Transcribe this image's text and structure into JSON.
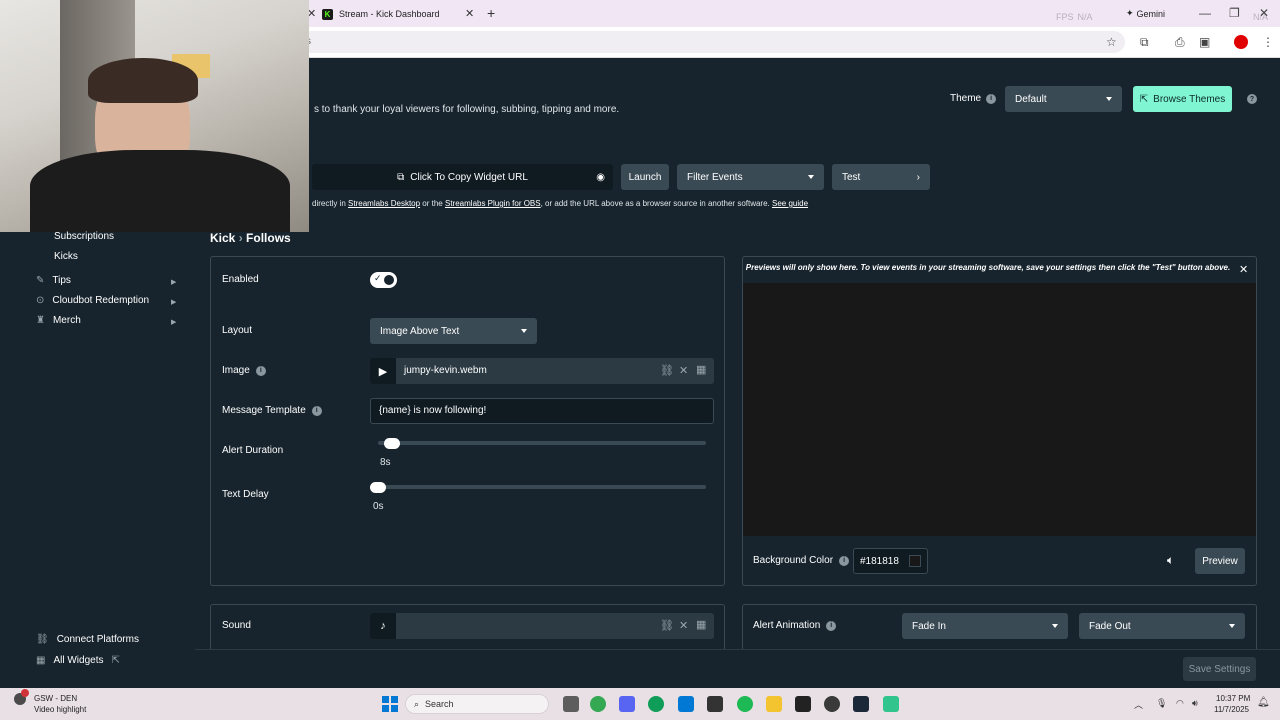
{
  "browser": {
    "tabs": [
      {
        "label": "Stream - Kick Dashboard"
      }
    ],
    "overlay_stats": {
      "fps": "FPS",
      "na1": "N/A",
      "gemini": "Gemini",
      "na2": "N/A"
    }
  },
  "header": {
    "description": "s to thank your loyal viewers for following, subbing, tipping and more.",
    "theme_label": "Theme",
    "theme_value": "Default",
    "browse_themes": "Browse Themes",
    "copy_url": "Click To Copy Widget URL",
    "launch": "Launch",
    "filter_events": "Filter Events",
    "test": "Test",
    "guide_prefix": "directly in",
    "guide_link1": "Streamlabs Desktop",
    "guide_mid": "or the",
    "guide_link2": "Streamlabs Plugin for OBS",
    "guide_suffix": ", or add the URL above as a browser source in another software.",
    "guide_link3": "See guide"
  },
  "sidebar": {
    "subitems": [
      "Subscriptions",
      "Kicks"
    ],
    "items": [
      {
        "label": "Tips",
        "icon": "tag-icon"
      },
      {
        "label": "Cloudbot Redemption",
        "icon": "bot-icon"
      },
      {
        "label": "Merch",
        "icon": "shirt-icon"
      }
    ],
    "footer": [
      {
        "label": "Connect Platforms",
        "icon": "link-icon"
      },
      {
        "label": "All Widgets",
        "icon": "grid-icon"
      }
    ]
  },
  "main": {
    "breadcrumb_parent": "Kick",
    "breadcrumb_sep": "›",
    "breadcrumb_current": "Follows",
    "enabled_label": "Enabled",
    "enabled": true,
    "layout_label": "Layout",
    "layout_value": "Image Above Text",
    "image_label": "Image",
    "image_file": "jumpy-kevin.webm",
    "message_label": "Message Template",
    "message_value": "{name} is now following!",
    "duration_label": "Alert Duration",
    "duration_value": "8s",
    "duration_fraction": 0.02,
    "delay_label": "Text Delay",
    "delay_value": "0s",
    "delay_fraction": 0.0,
    "sound_label": "Sound"
  },
  "preview": {
    "note": "Previews will only show here. To view events in your streaming software, save your settings then click the \"Test\" button above.",
    "bg_color_label": "Background Color",
    "bg_color_value": "#181818",
    "preview_button": "Preview",
    "animation_label": "Alert Animation",
    "anim_in": "Fade In",
    "anim_out": "Fade Out"
  },
  "footer": {
    "save": "Save Settings"
  },
  "taskbar": {
    "notification": "GSW - DEN",
    "notification_sub": "Video highlight",
    "search": "Search",
    "time": "10:37 PM",
    "date": "11/7/2025"
  },
  "colors": {
    "accent": "#80f5d2",
    "bg": "#17242d",
    "preview_bg": "#181818"
  }
}
